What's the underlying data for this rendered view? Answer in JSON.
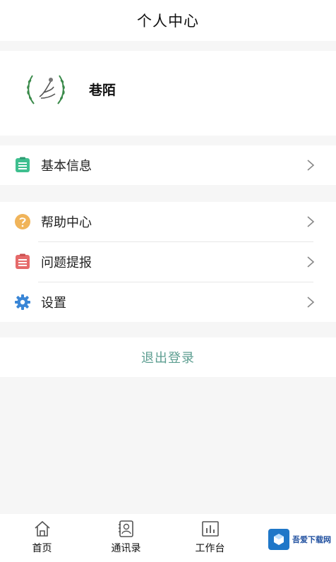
{
  "header": {
    "title": "个人中心"
  },
  "profile": {
    "name": "巷陌"
  },
  "menu_basic": {
    "label": "基本信息",
    "icon": "clipboard-green-icon",
    "color": "#3fbf8f"
  },
  "menu_group": [
    {
      "label": "帮助中心",
      "icon": "question-circle-icon",
      "color": "#f0b45a"
    },
    {
      "label": "问题提报",
      "icon": "clipboard-red-icon",
      "color": "#e56a6a"
    },
    {
      "label": "设置",
      "icon": "gear-icon",
      "color": "#3a86d6"
    }
  ],
  "logout": {
    "label": "退出登录",
    "color": "#5d9e91"
  },
  "tabs": [
    {
      "label": "首页",
      "icon": "home-icon"
    },
    {
      "label": "通讯录",
      "icon": "contacts-icon"
    },
    {
      "label": "工作台",
      "icon": "workbench-chart-icon"
    },
    {
      "label": "",
      "icon": ""
    }
  ],
  "watermark": {
    "text": "吾爱下载网"
  }
}
